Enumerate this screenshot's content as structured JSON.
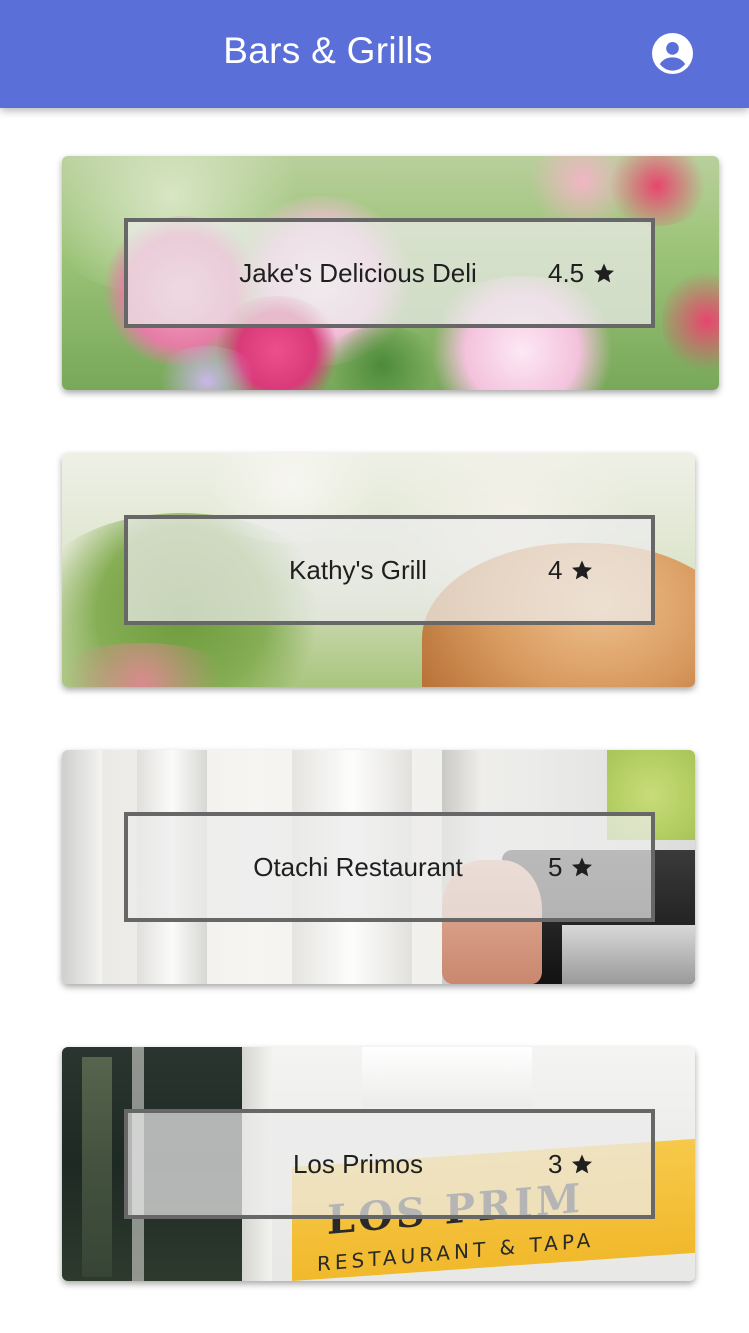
{
  "header": {
    "title": "Bars & Grills",
    "account_icon": "account-circle-icon",
    "color": "#5b6fd9"
  },
  "restaurants": [
    {
      "name": "Jake's Delicious Deli",
      "rating": "4.5",
      "image": "pink and white flowers"
    },
    {
      "name": "Kathy's Grill",
      "rating": "4",
      "image": "burger bun on green background"
    },
    {
      "name": "Otachi Restaurant",
      "rating": "5",
      "image": "white columns and camera"
    },
    {
      "name": "Los Primos",
      "rating": "3",
      "image": "restaurant storefront sign"
    }
  ],
  "rating_icon": "star-icon"
}
